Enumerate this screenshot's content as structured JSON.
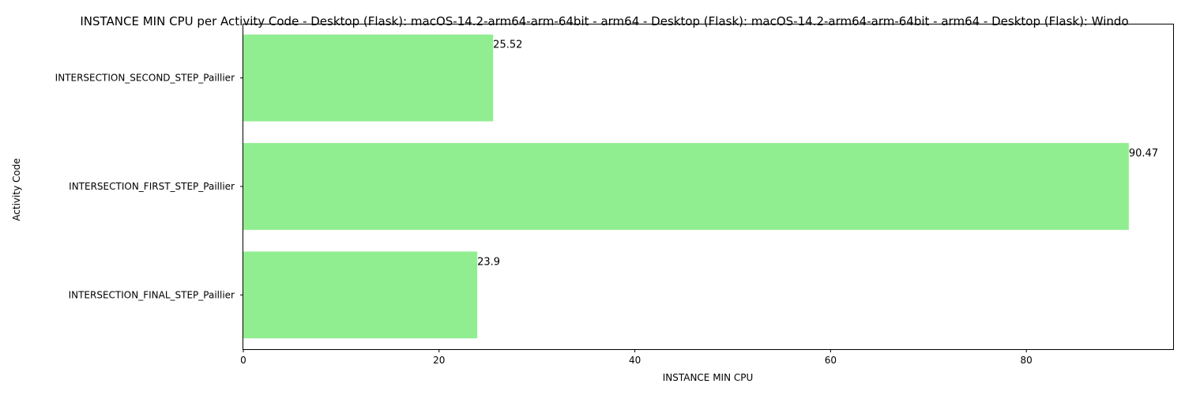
{
  "chart_data": {
    "type": "bar",
    "orientation": "horizontal",
    "title": "INSTANCE MIN CPU per Activity Code - Desktop (Flask): macOS-14.2-arm64-arm-64bit - arm64 - Desktop (Flask): macOS-14.2-arm64-arm-64bit - arm64 - Desktop (Flask): Windo",
    "xlabel": "INSTANCE MIN CPU",
    "ylabel": "Activity Code",
    "categories": [
      "INTERSECTION_SECOND_STEP_Paillier",
      "INTERSECTION_FIRST_STEP_Paillier",
      "INTERSECTION_FINAL_STEP_Paillier"
    ],
    "values": [
      25.52,
      90.47,
      23.9
    ],
    "value_labels": [
      "25.52",
      "90.47",
      "23.9"
    ],
    "xlim": [
      0,
      95
    ],
    "xticks": [
      0,
      20,
      40,
      60,
      80
    ],
    "xtick_labels": [
      "0",
      "20",
      "40",
      "60",
      "80"
    ],
    "bar_color": "#90ee90",
    "grid": false,
    "legend": "none"
  }
}
